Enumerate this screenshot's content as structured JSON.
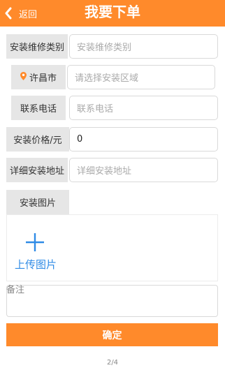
{
  "header": {
    "back_label": "返回",
    "title": "我要下单"
  },
  "form": {
    "category": {
      "label": "安装维修类别",
      "placeholder": "安装维修类别"
    },
    "region": {
      "city": "许昌市",
      "placeholder": "请选择安装区域"
    },
    "phone": {
      "label": "联系电话",
      "placeholder": "联系电话"
    },
    "price": {
      "label": "安装价格/元",
      "value": "0"
    },
    "address": {
      "label": "详细安装地址",
      "placeholder": "详细安装地址"
    },
    "images": {
      "label": "安装图片",
      "upload_label": "上传图片"
    },
    "remark": {
      "placeholder": "备注"
    }
  },
  "confirm_label": "确定",
  "page_indicator": "2/4",
  "colors": {
    "accent": "#ff8a2b",
    "upload_blue": "#2f8be6"
  }
}
